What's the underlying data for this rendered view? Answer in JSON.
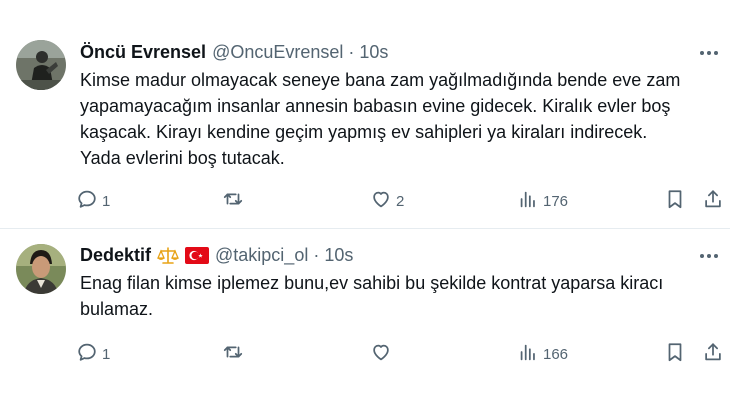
{
  "tweets": [
    {
      "display_name": "Öncü Evrensel",
      "handle": "@OncuEvrensel",
      "dot": "·",
      "time": "10s",
      "text": "Kimse madur olmayacak seneye bana zam yağılmadığında bende eve zam\nyapamayacağım insanlar annesin babasın evine gidecek. Kiralık evler boş\nkaşacak. Kirayı kendine geçim yapmış ev sahipleri ya kiraları indirecek.\nYada evlerini boş tutacak.",
      "replies": "1",
      "retweets": "",
      "likes": "2",
      "views": "176"
    },
    {
      "display_name": "Dedektif",
      "handle": "@takipci_ol",
      "dot": "·",
      "time": "10s",
      "badges": [
        "balance-scale-emoji",
        "turkey-flag-emoji"
      ],
      "text": "Enag filan kimse iplemez bunu,ev sahibi bu şekilde kontrat yaparsa kiracı\nbulamaz.",
      "replies": "1",
      "retweets": "",
      "likes": "",
      "views": "166"
    }
  ],
  "icons": [
    "more-icon",
    "reply-icon",
    "retweet-icon",
    "like-icon",
    "views-icon",
    "bookmark-icon",
    "share-icon"
  ],
  "colors": {
    "text": "#0f1419",
    "secondary": "#536471",
    "divider": "#e6ecf0",
    "flag": "#e30a17",
    "scale": "#e8a317"
  }
}
